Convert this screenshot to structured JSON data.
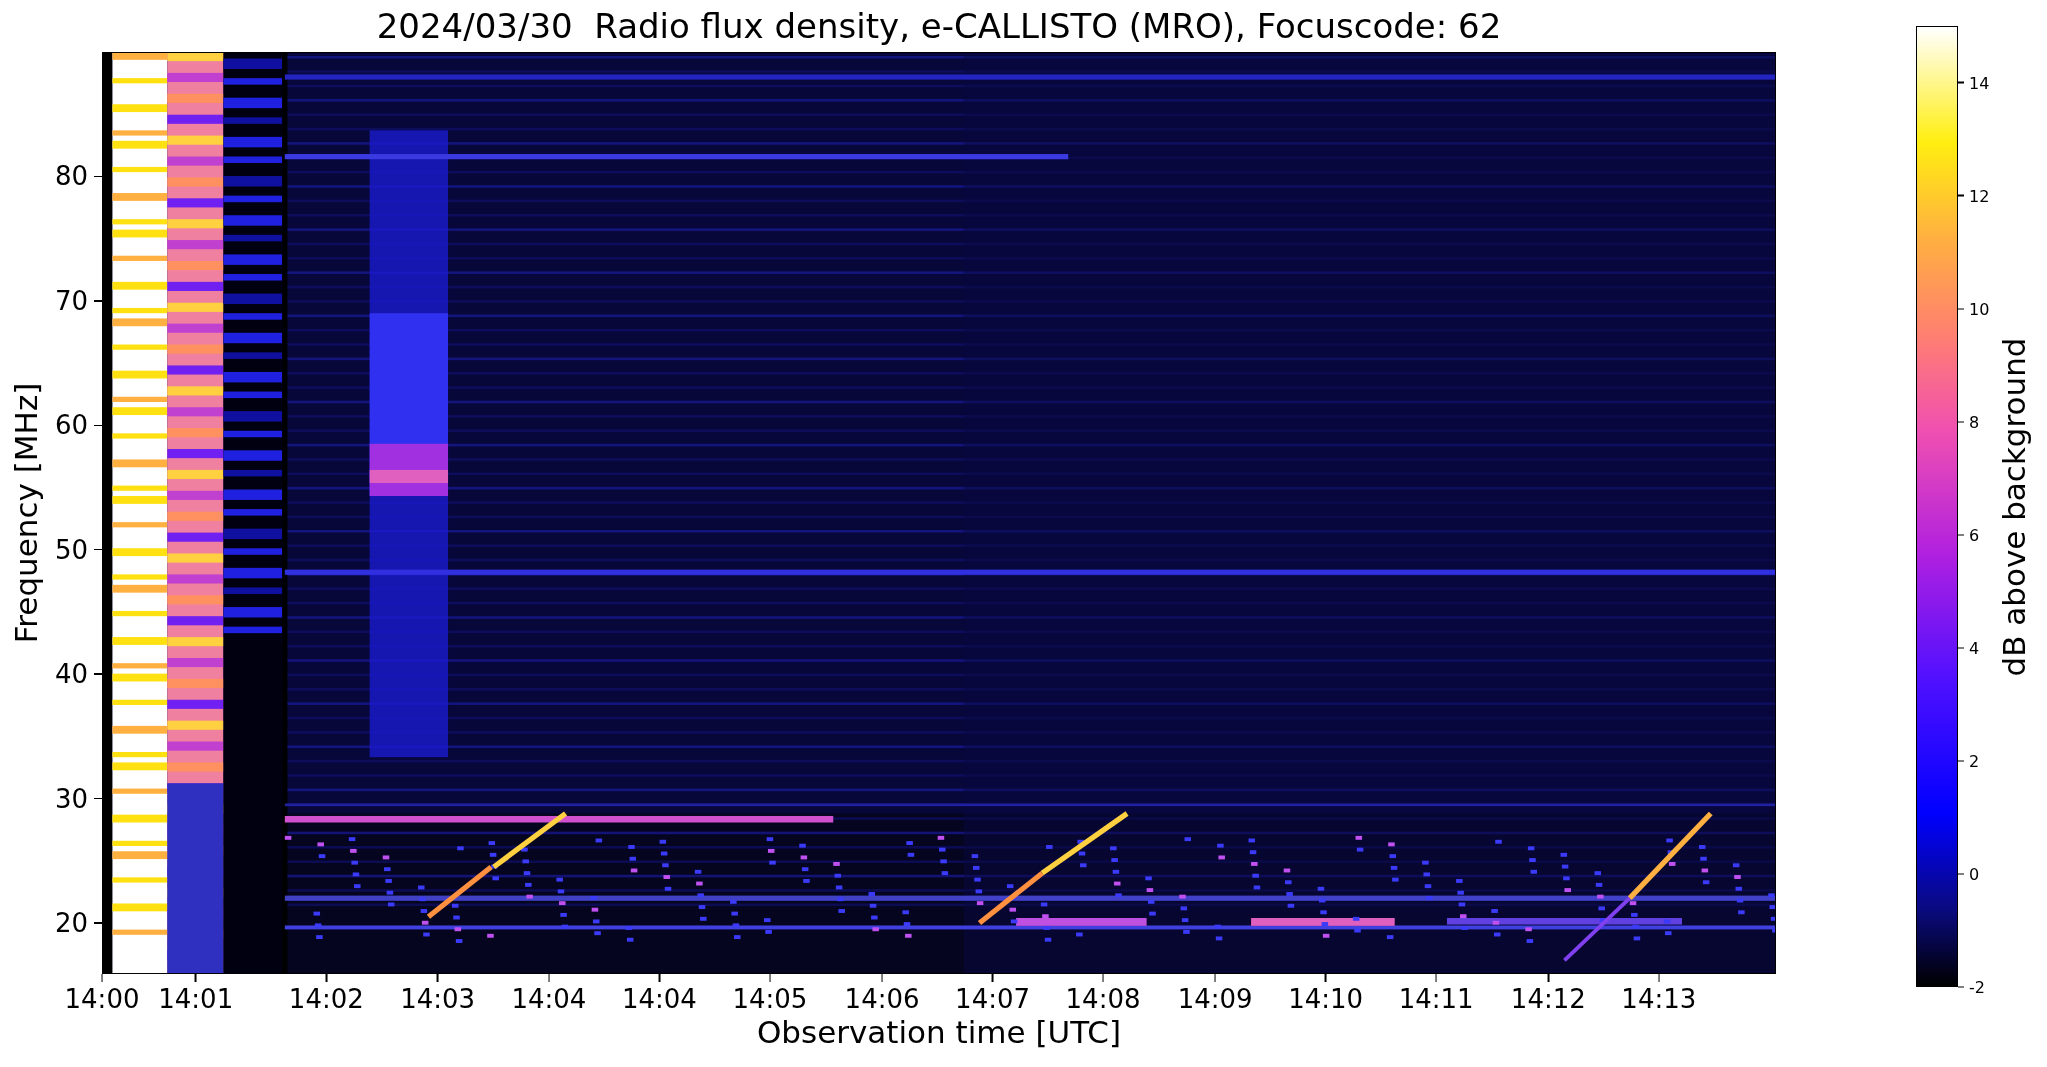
{
  "title": "2024/03/30  Radio flux density, e-CALLISTO (MRO), Focuscode: 62",
  "plot": {
    "xlabel": "Observation time [UTC]",
    "ylabel": "Frequency [MHz]",
    "xticks": [
      "14:00",
      "14:01",
      "14:02",
      "14:03",
      "14:04",
      "14:04",
      "14:05",
      "14:06",
      "14:07",
      "14:08",
      "14:09",
      "14:10",
      "14:11",
      "14:12",
      "14:13"
    ],
    "yticks": [
      "80",
      "70",
      "60",
      "50",
      "40",
      "30",
      "20"
    ]
  },
  "colorbar": {
    "label": "dB above background",
    "ticks": [
      "14",
      "12",
      "10",
      "8",
      "6",
      "4",
      "2",
      "0",
      "-2"
    ]
  }
}
